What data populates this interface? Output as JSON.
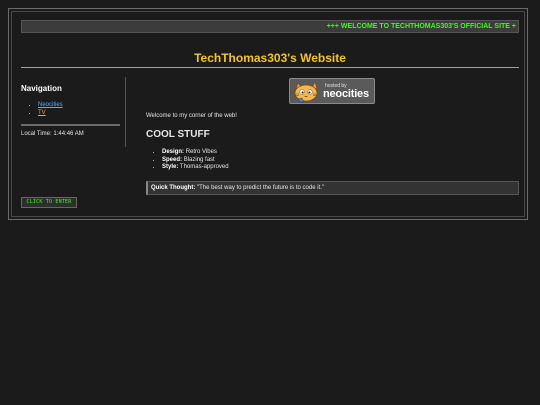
{
  "marquee": {
    "text": "+++ WELCOME TO TECHTHOMAS303'S OFFICIAL SITE +"
  },
  "header": {
    "title": "TechThomas303's Website"
  },
  "sidebar": {
    "heading": "Navigation",
    "links": [
      {
        "label": "Neocities"
      },
      {
        "label": "TV"
      }
    ],
    "time_label": "Local Time:",
    "time_value": "1:44:46 AM"
  },
  "enter_button": {
    "label": "CLICK TO ENTER"
  },
  "badge": {
    "hosted_text": "hosted by",
    "brand_text": "neocities"
  },
  "main": {
    "welcome": "Welcome to my corner of the web!",
    "heading": "COOL STUFF",
    "features": [
      {
        "key": "Design:",
        "value": "Retro Vibes"
      },
      {
        "key": "Speed:",
        "value": "Blazing fast"
      },
      {
        "key": "Style:",
        "value": "Thomas-approved"
      }
    ],
    "quote_label": "Quick Thought:",
    "quote_text": "\"The best way to predict the future is to code it.\""
  },
  "colors": {
    "background": "#1b1b1b",
    "accent_title": "#f5c518",
    "marquee_text": "#39ff14",
    "link_primary": "#4fb3ff",
    "link_secondary": "#ff9a3c"
  }
}
